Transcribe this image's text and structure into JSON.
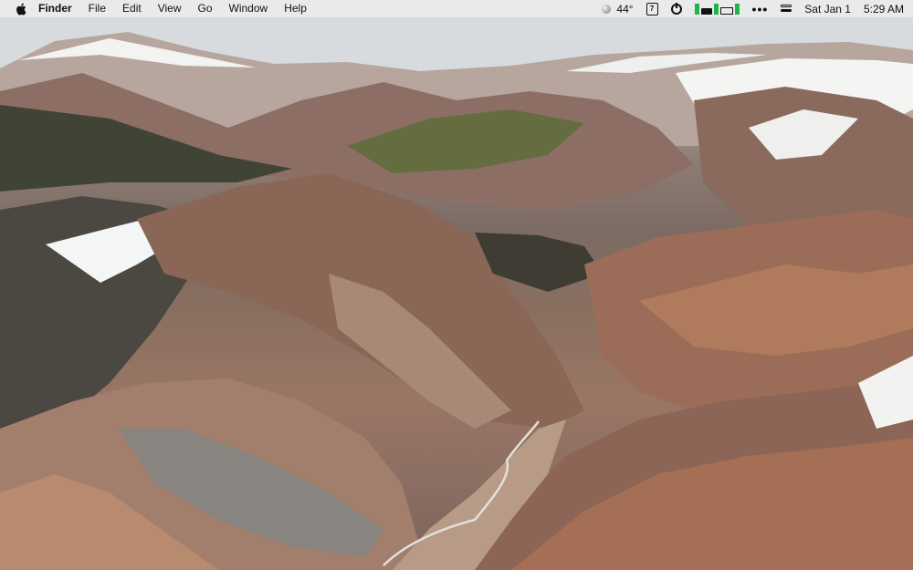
{
  "menubar": {
    "app_name": "Finder",
    "menus": [
      "File",
      "Edit",
      "View",
      "Go",
      "Window",
      "Help"
    ],
    "status": {
      "temperature": "44°",
      "calendar_day": "7",
      "date": "Sat Jan 1",
      "time": "5:29 AM"
    }
  },
  "icons": {
    "apple": "apple-icon",
    "weather": "weather-icon",
    "calendar": "calendar-icon",
    "power": "power-icon",
    "stats": "stats-icon",
    "battery": "battery-icon",
    "more": "more-icon",
    "control_center": "control-center-icon"
  },
  "colors": {
    "menubar_bg": "#ececec",
    "text": "#111111",
    "stats_green": "#22b14c"
  }
}
